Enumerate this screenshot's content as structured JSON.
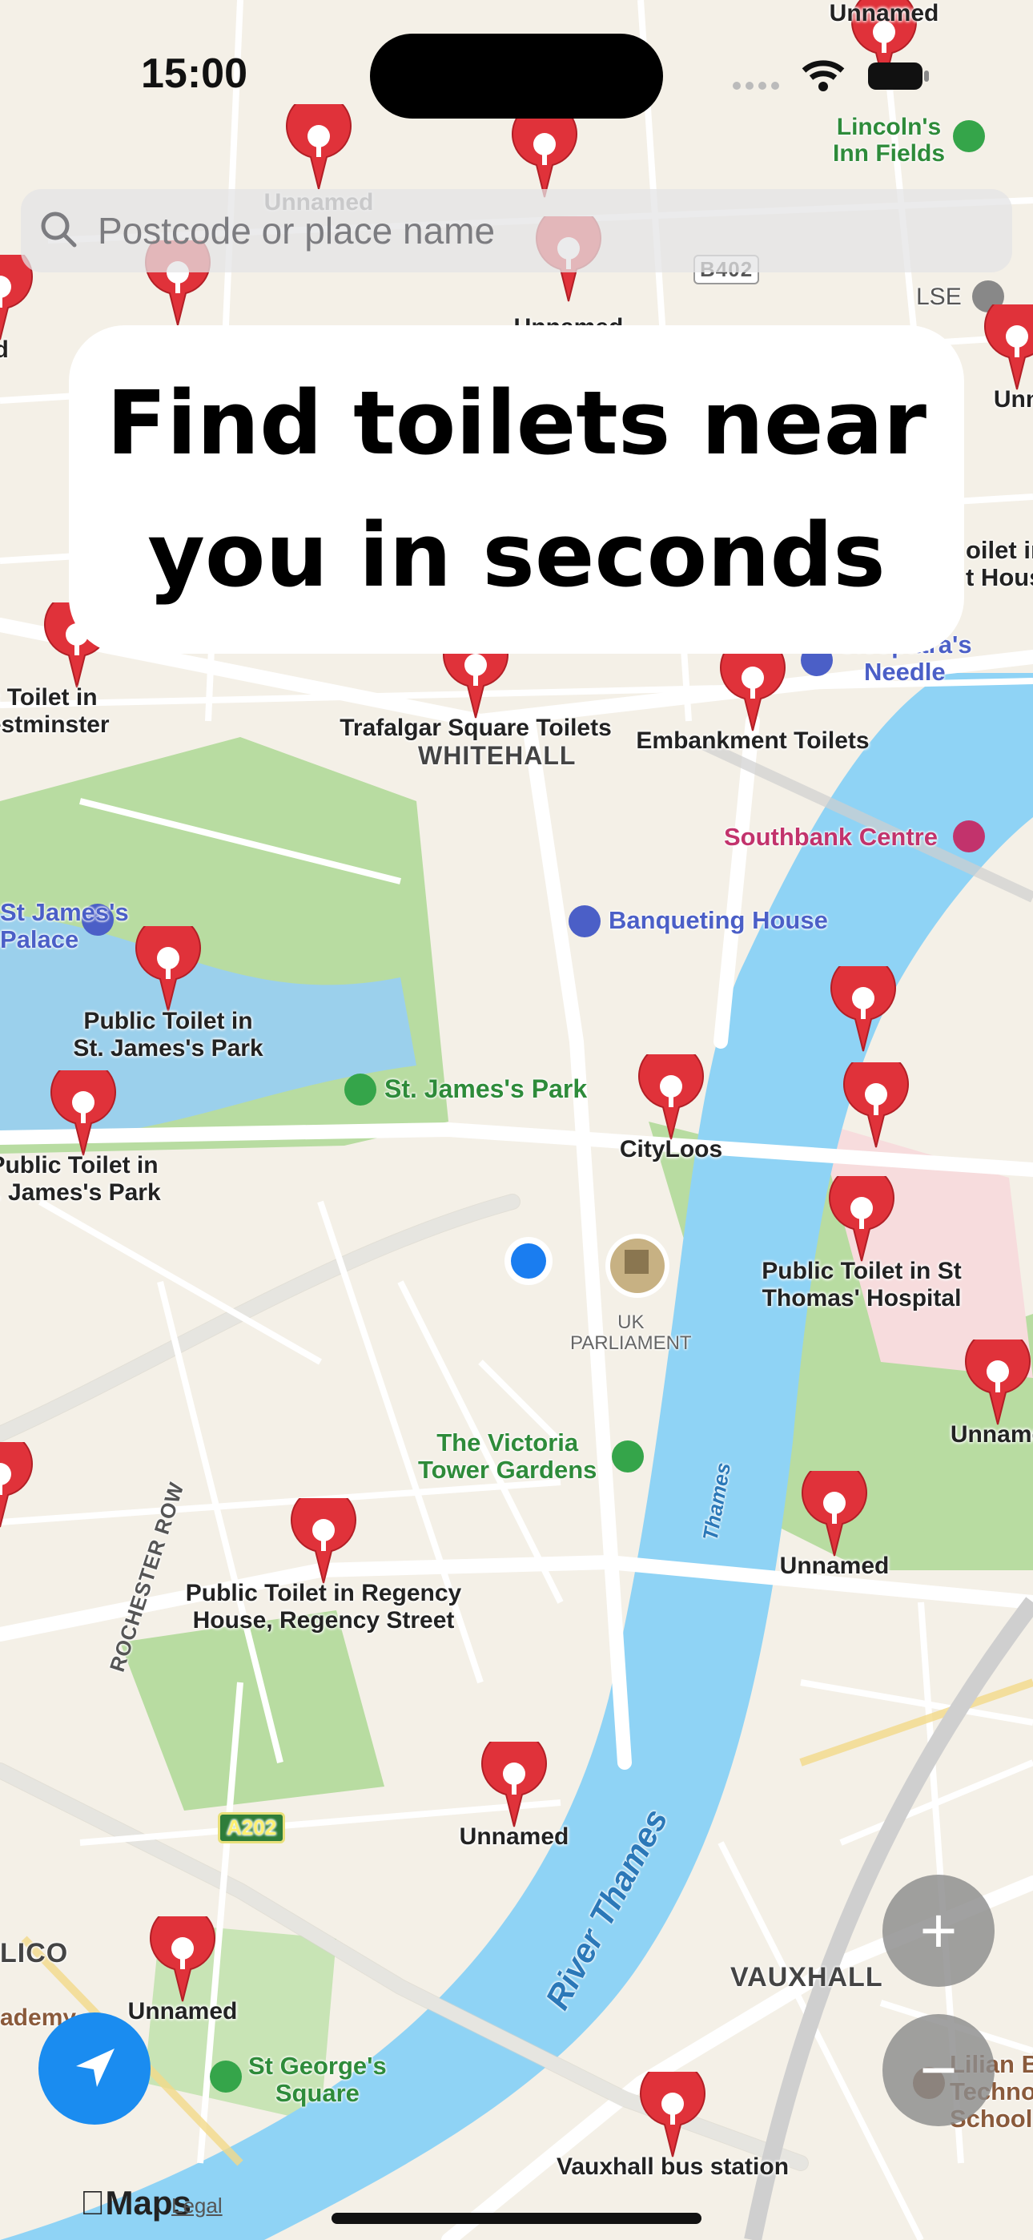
{
  "status_bar": {
    "time": "15:00"
  },
  "search": {
    "placeholder": "Postcode or place name"
  },
  "headline": {
    "line1": "Find toilets near",
    "line2": "you in seconds"
  },
  "map_labels": {
    "lincolns": "Lincoln's\nInn Fields",
    "lse": "LSE",
    "b402": "B402",
    "whitehall": "WHITEHALL",
    "southbank": "Southbank Centre",
    "banqueting": "Banqueting House",
    "cleopatra": "Cleopatra's\nNeedle",
    "st_james_park": "St. James's Park",
    "st_james_palace": "St James's\nPalace",
    "uk_parliament": "UK\nPARLIAMENT",
    "victoria_tower": "The Victoria\nTower Gardens",
    "thames": "Thames",
    "river_thames": "River Thames",
    "rochester_row": "ROCHESTER ROW",
    "a202": "A202",
    "vauxhall": "VAUXHALL",
    "st_georges": "St George's\nSquare",
    "pimlico": "LICO",
    "academy": "ademy",
    "lilian": "Lilian B\nTechno\nSchool",
    "toilet_house": "oilet in\nt House",
    "maps": "Maps",
    "legal": "Legal"
  },
  "pins": [
    {
      "label": "Unnamed"
    },
    {
      "label": ""
    },
    {
      "label": "Unnamed"
    },
    {
      "label": "Unnamed"
    },
    {
      "label": ""
    },
    {
      "label": "Public Toilet in\ny of Westminster"
    },
    {
      "label": "Trafalgar Square Toilets"
    },
    {
      "label": "Embankment Toilets"
    },
    {
      "label": "Public Toilet in\nSt. James's Park"
    },
    {
      "label": "Public Toilet in\nt. James's Park"
    },
    {
      "label": "CityLoos"
    },
    {
      "label": ""
    },
    {
      "label": ""
    },
    {
      "label": "Public Toilet in St\nThomas' Hospital"
    },
    {
      "label": "Unname"
    },
    {
      "label": ""
    },
    {
      "label": "Unnamed"
    },
    {
      "label": "Public Toilet in Regency\nHouse, Regency Street"
    },
    {
      "label": "Unnamed"
    },
    {
      "label": "Unnamed"
    },
    {
      "label": "Vauxhall bus station"
    },
    {
      "label": "med"
    },
    {
      "label": "Unn"
    }
  ],
  "controls": {
    "zoom_in": "+",
    "zoom_out": "−"
  },
  "colors": {
    "pin": "#e0323a",
    "water": "#8fd3f5",
    "park": "#b6dba0",
    "accent": "#1a8cf0"
  }
}
